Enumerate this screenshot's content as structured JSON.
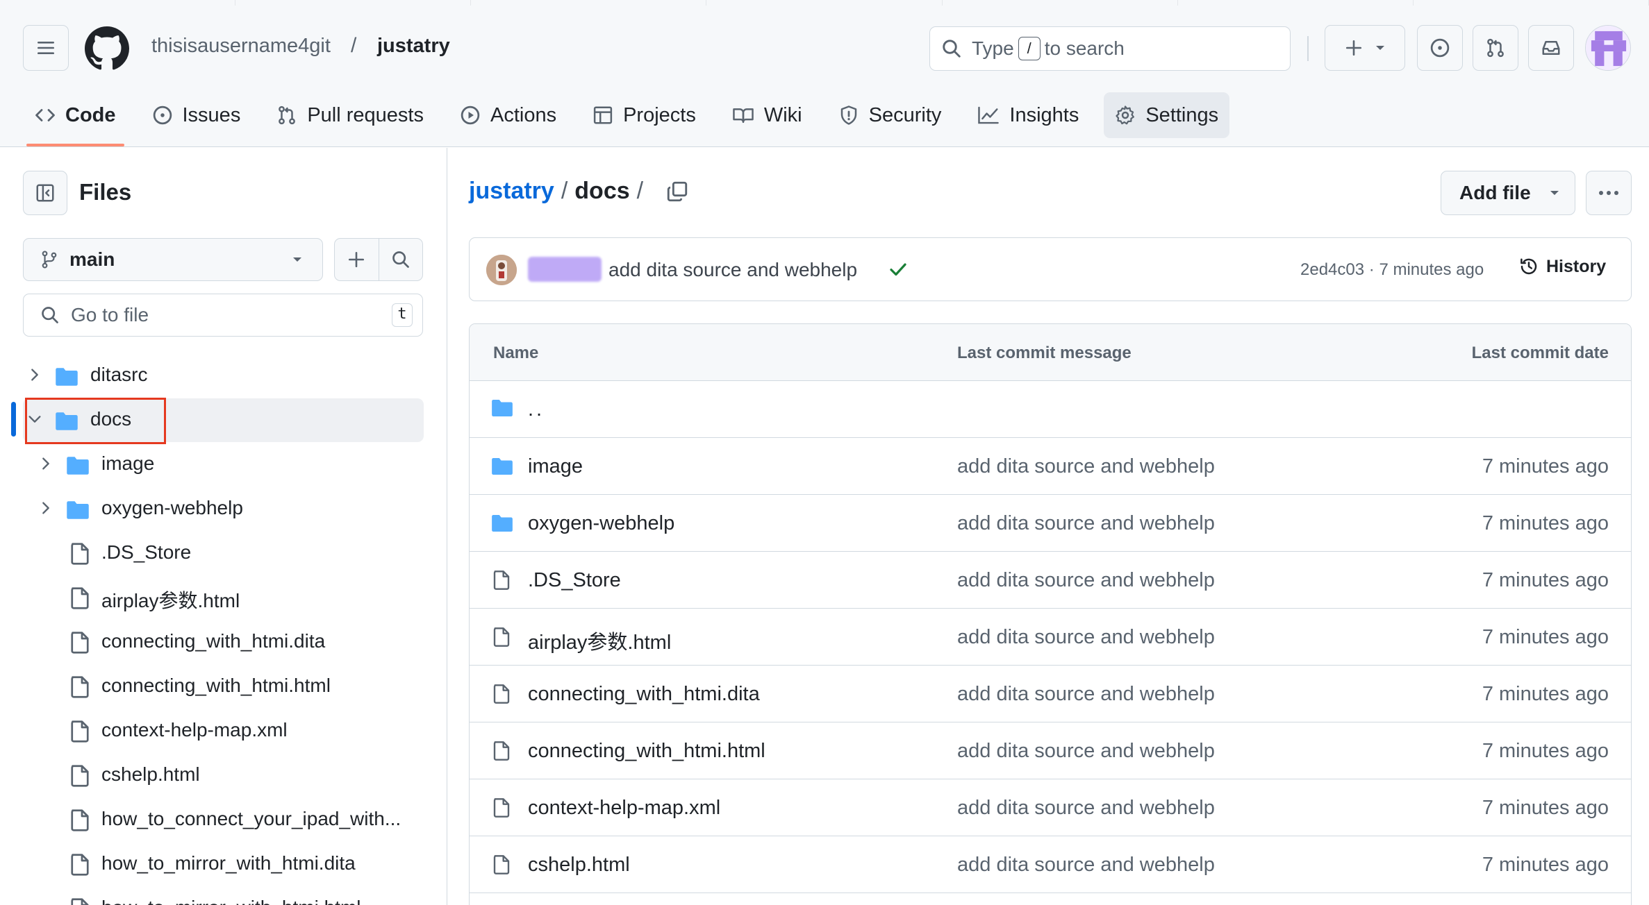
{
  "header": {
    "owner": "thisisausername4git",
    "separator": "/",
    "repo": "justatry",
    "search": {
      "prefix": "Type",
      "key": "/",
      "suffix": "to search"
    }
  },
  "repo_nav": {
    "tabs": [
      {
        "label": "Code",
        "icon": "code-icon",
        "selected": true
      },
      {
        "label": "Issues",
        "icon": "issue-icon"
      },
      {
        "label": "Pull requests",
        "icon": "pull-request-icon"
      },
      {
        "label": "Actions",
        "icon": "play-icon"
      },
      {
        "label": "Projects",
        "icon": "table-icon"
      },
      {
        "label": "Wiki",
        "icon": "book-icon"
      },
      {
        "label": "Security",
        "icon": "shield-icon"
      },
      {
        "label": "Insights",
        "icon": "graph-icon"
      },
      {
        "label": "Settings",
        "icon": "gear-icon",
        "hovered": true
      }
    ]
  },
  "sidebar": {
    "title": "Files",
    "branch": "main",
    "goto_placeholder": "Go to file",
    "goto_hotkey": "t",
    "tree": [
      {
        "name": "ditasrc",
        "type": "folder",
        "level": 0,
        "expanded": false
      },
      {
        "name": "docs",
        "type": "folder",
        "level": 0,
        "expanded": true,
        "selected": true
      },
      {
        "name": "image",
        "type": "folder",
        "level": 1,
        "expanded": false
      },
      {
        "name": "oxygen-webhelp",
        "type": "folder",
        "level": 1,
        "expanded": false
      },
      {
        "name": ".DS_Store",
        "type": "file",
        "level": 1
      },
      {
        "name": "airplay参数.html",
        "type": "file",
        "level": 1
      },
      {
        "name": "connecting_with_htmi.dita",
        "type": "file",
        "level": 1
      },
      {
        "name": "connecting_with_htmi.html",
        "type": "file",
        "level": 1
      },
      {
        "name": "context-help-map.xml",
        "type": "file",
        "level": 1
      },
      {
        "name": "cshelp.html",
        "type": "file",
        "level": 1
      },
      {
        "name": "how_to_connect_your_ipad_with...",
        "type": "file",
        "level": 1
      },
      {
        "name": "how_to_mirror_with_htmi.dita",
        "type": "file",
        "level": 1
      },
      {
        "name": "how_to_mirror_with_htmi.html",
        "type": "file",
        "level": 1
      }
    ]
  },
  "main": {
    "breadcrumb": {
      "repo": "justatry",
      "sep": "/",
      "current": "docs",
      "trail": "/"
    },
    "add_file_label": "Add file",
    "commit": {
      "message": "add dita source and webhelp",
      "sha": "2ed4c03",
      "dot": "·",
      "time": "7 minutes ago",
      "history_label": "History"
    },
    "table": {
      "headers": {
        "name": "Name",
        "message": "Last commit message",
        "date": "Last commit date"
      },
      "parent": "..",
      "rows": [
        {
          "name": "image",
          "type": "folder",
          "message": "add dita source and webhelp",
          "date": "7 minutes ago"
        },
        {
          "name": "oxygen-webhelp",
          "type": "folder",
          "message": "add dita source and webhelp",
          "date": "7 minutes ago"
        },
        {
          "name": ".DS_Store",
          "type": "file",
          "message": "add dita source and webhelp",
          "date": "7 minutes ago"
        },
        {
          "name": "airplay参数.html",
          "type": "file",
          "message": "add dita source and webhelp",
          "date": "7 minutes ago"
        },
        {
          "name": "connecting_with_htmi.dita",
          "type": "file",
          "message": "add dita source and webhelp",
          "date": "7 minutes ago"
        },
        {
          "name": "connecting_with_htmi.html",
          "type": "file",
          "message": "add dita source and webhelp",
          "date": "7 minutes ago"
        },
        {
          "name": "context-help-map.xml",
          "type": "file",
          "message": "add dita source and webhelp",
          "date": "7 minutes ago"
        },
        {
          "name": "cshelp.html",
          "type": "file",
          "message": "add dita source and webhelp",
          "date": "7 minutes ago"
        }
      ]
    }
  },
  "colors": {
    "accent_link": "#0969da",
    "folder": "#54aeff",
    "selected_underline": "#fd8c73",
    "highlight_box": "#e5391f",
    "success": "#1a7f37",
    "avatar": "#b49cf5"
  }
}
